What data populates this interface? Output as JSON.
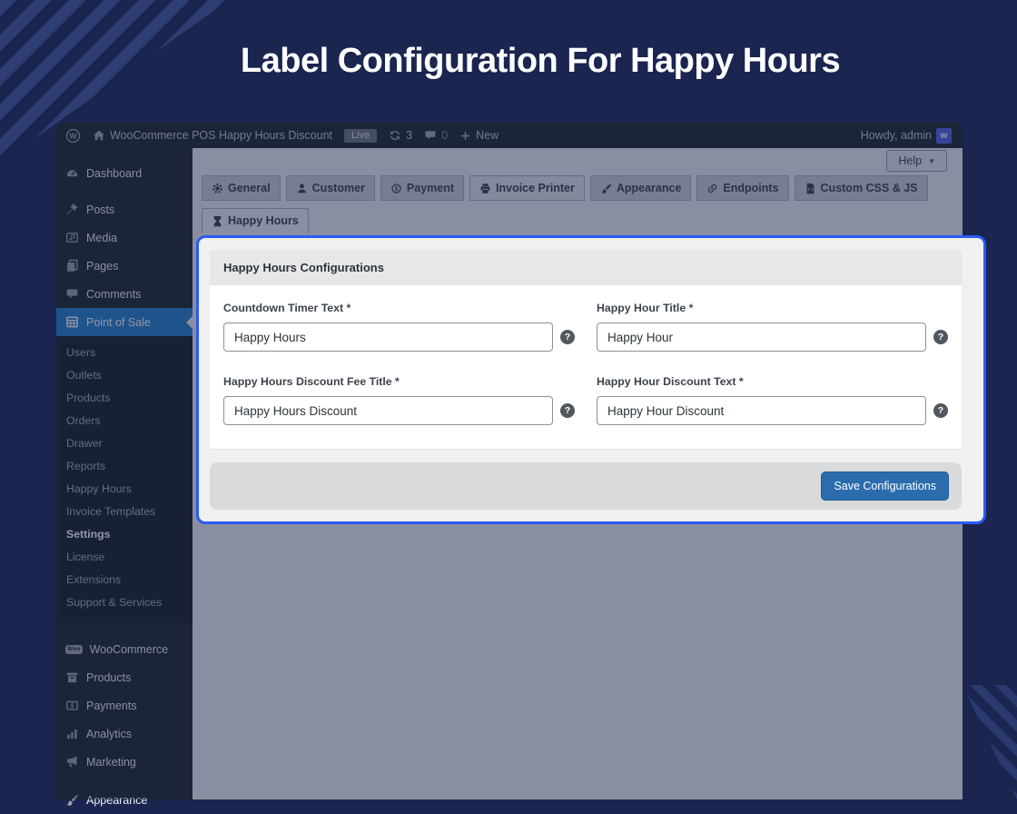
{
  "page_title": "Label Configuration For Happy Hours",
  "admin_bar": {
    "site_name": "WooCommerce POS Happy Hours Discount",
    "live_badge": "Live",
    "updates_count": "3",
    "comments_count": "0",
    "new_label": "New",
    "howdy": "Howdy, admin",
    "wp_logo_letter": "W",
    "avatar_letter": "w"
  },
  "sidebar": {
    "items": [
      "Dashboard",
      "Posts",
      "Media",
      "Pages",
      "Comments",
      "Point of Sale"
    ],
    "active_item": "Point of Sale",
    "submenu": [
      "Users",
      "Outlets",
      "Products",
      "Orders",
      "Drawer",
      "Reports",
      "Happy Hours",
      "Invoice Templates",
      "Settings",
      "License",
      "Extensions",
      "Support & Services"
    ],
    "current_submenu_item": "Settings",
    "bottom_items": [
      "WooCommerce",
      "Products",
      "Payments",
      "Analytics",
      "Marketing",
      "Appearance"
    ],
    "woo_badge": "Woo"
  },
  "content": {
    "help_label": "Help",
    "tabs": [
      "General",
      "Customer",
      "Payment",
      "Invoice Printer",
      "Appearance",
      "Endpoints",
      "Custom CSS & JS",
      "Happy Hours"
    ],
    "active_tab": "Happy Hours",
    "panel": {
      "title": "Happy Hours Configurations",
      "fields": [
        {
          "label": "Countdown Timer Text *",
          "value": "Happy Hours"
        },
        {
          "label": "Happy Hour Title *",
          "value": "Happy Hour"
        },
        {
          "label": "Happy Hours Discount Fee Title *",
          "value": "Happy Hours Discount"
        },
        {
          "label": "Happy Hour Discount Text *",
          "value": "Happy Hour Discount"
        }
      ],
      "help_icon_glyph": "?",
      "save_label": "Save Configurations"
    }
  },
  "icons": {
    "dollar": "$",
    "chevron_down": "▼"
  },
  "colors": {
    "page_background": "#1a2550",
    "corner_stripe": "#2e3d72",
    "highlight_border": "#2b5af5",
    "primary_button": "#2a6cac",
    "active_menu_item": "#2980c9",
    "panel_background": "#f0f0f1"
  }
}
